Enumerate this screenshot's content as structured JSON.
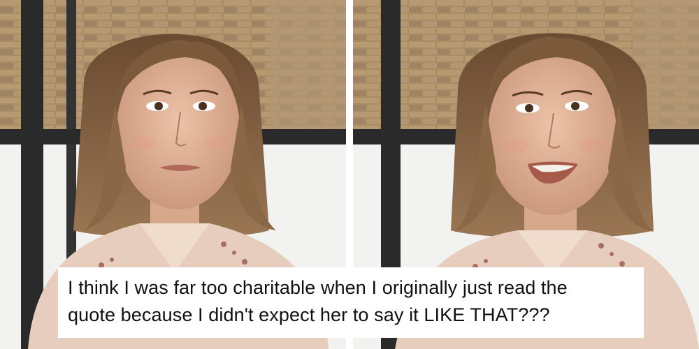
{
  "caption": {
    "line1": "I think I was far too charitable when I originally just read the",
    "line2": "quote because I didn't expect her to say it LIKE THAT???"
  },
  "panels": [
    {
      "expression": "lip-bite"
    },
    {
      "expression": "speaking-smile"
    }
  ],
  "colors": {
    "background": "#ffffff",
    "brick": "#a88c66",
    "window_frame": "#2a2a2a",
    "hair": "#7a5a3a",
    "skin": "#e2b49a",
    "blouse": "#e6cdbe"
  }
}
